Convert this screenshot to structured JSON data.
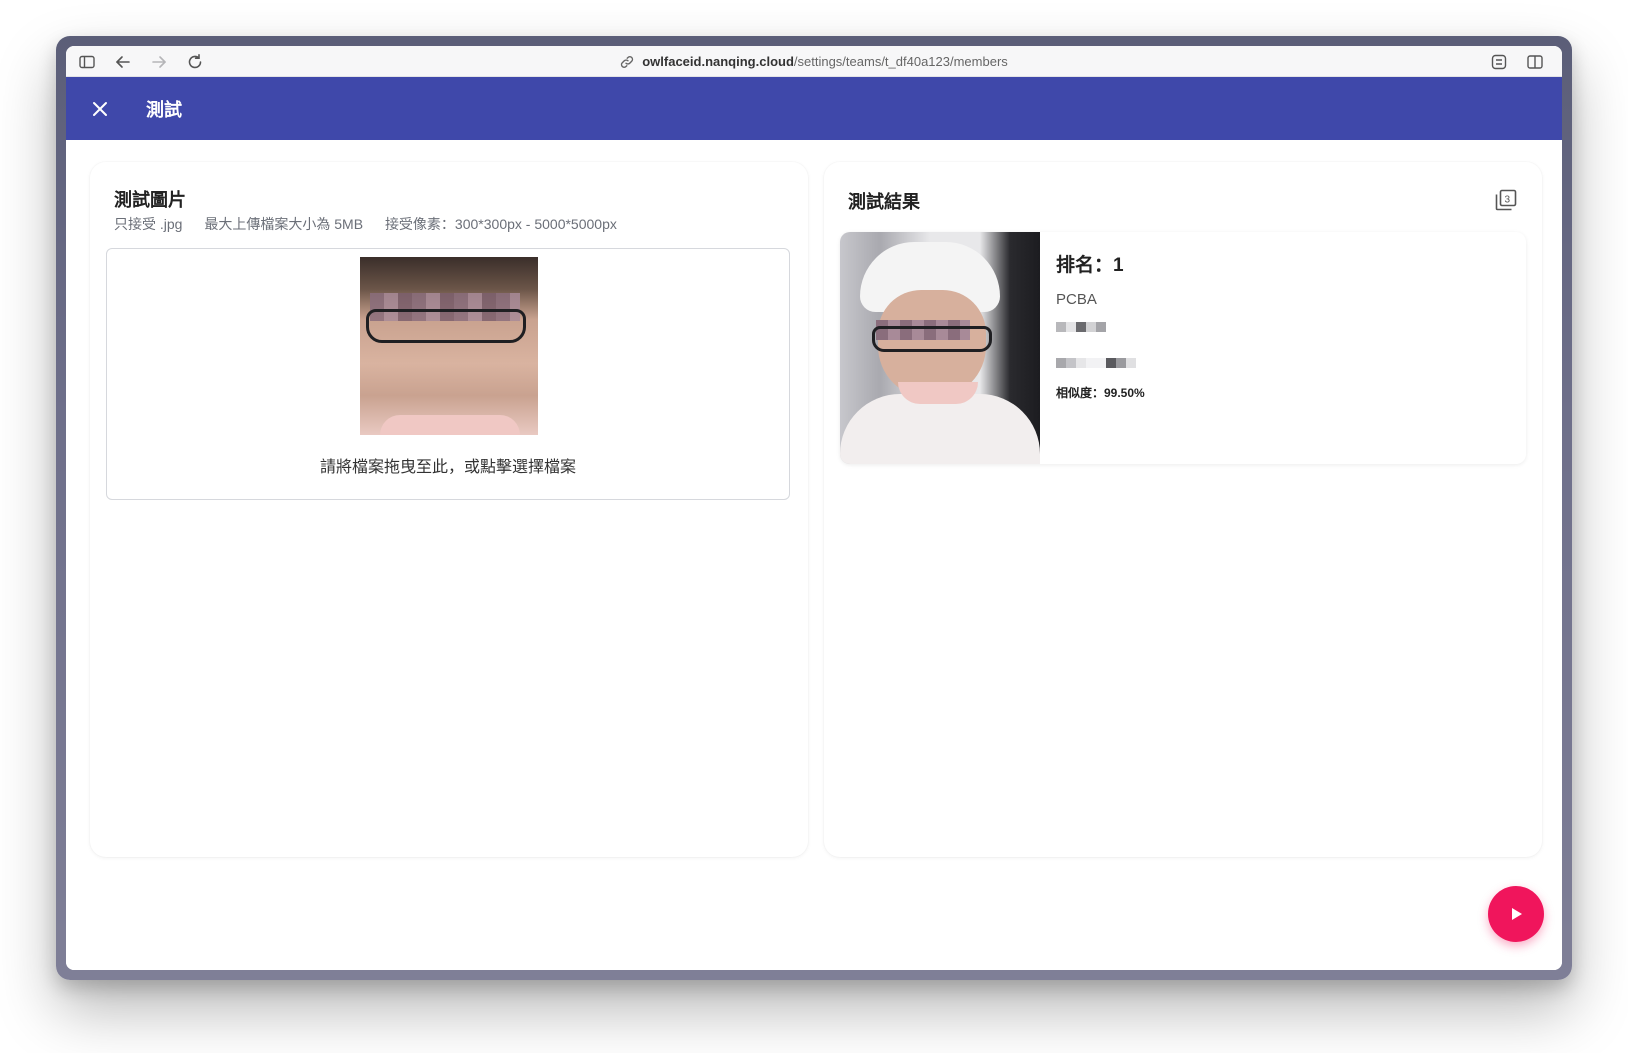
{
  "browser": {
    "url_host": "owlfaceid.nanqing.cloud",
    "url_path": "/settings/teams/t_df40a123/members"
  },
  "header": {
    "title": "測試"
  },
  "test_image": {
    "title": "測試圖片",
    "hints": [
      "只接受 .jpg",
      "最大上傳檔案大小為 5MB",
      "接受像素：300*300px - 5000*5000px"
    ],
    "dropzone_text": "請將檔案拖曳至此，或點擊選擇檔案"
  },
  "test_result": {
    "title": "測試結果",
    "count_icon": "filter-3-icon",
    "results": [
      {
        "rank": "排名：1",
        "department": "PCBA",
        "similarity": "相似度：99.50%"
      }
    ]
  },
  "colors": {
    "header": "#3f48aa",
    "fab": "#f0155c"
  },
  "fab": {
    "icon": "play-icon"
  }
}
